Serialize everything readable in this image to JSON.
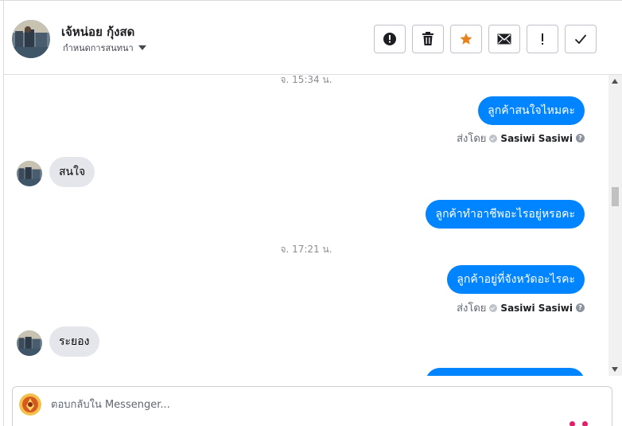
{
  "header": {
    "name": "เจ้หน่อย กุ้งสด",
    "assign_label": "กำหนดการสนทนา",
    "actions": [
      {
        "name": "report-button",
        "icon": "alert-circle-icon"
      },
      {
        "name": "delete-button",
        "icon": "trash-icon"
      },
      {
        "name": "star-button",
        "icon": "star-icon",
        "color": "#e7821d"
      },
      {
        "name": "unread-button",
        "icon": "envelope-icon"
      },
      {
        "name": "follow-up-button",
        "icon": "exclamation-icon"
      },
      {
        "name": "done-button",
        "icon": "check-icon"
      }
    ]
  },
  "chat": {
    "timestamps": [
      "จ. 15:34 น.",
      "จ. 17:21 น."
    ],
    "messages": [
      {
        "dir": "out",
        "text": "ลูกค้าสนใจไหมคะ"
      },
      {
        "dir": "in",
        "text": "สนใจ"
      },
      {
        "dir": "out",
        "text": "ลูกค้าทำอาชีพอะไรอยู่หรอคะ"
      },
      {
        "dir": "out",
        "text": "ลูกค้าอยู่ที่จังหวัดอะไรคะ"
      },
      {
        "dir": "in",
        "text": "ระยอง"
      },
      {
        "dir": "out",
        "text": ""
      }
    ],
    "sent_by": [
      {
        "prefix": "ส่งโดย",
        "name": "Sasiwi Sasiwi"
      },
      {
        "prefix": "ส่งโดย",
        "name": "Sasiwi Sasiwi"
      }
    ]
  },
  "composer": {
    "placeholder": "ตอบกลับใน Messenger..."
  },
  "colors": {
    "outgoing_bubble": "#0084ff",
    "incoming_bubble": "#e4e6eb",
    "star": "#e7821d",
    "typing_dots": "#e41e6b"
  }
}
